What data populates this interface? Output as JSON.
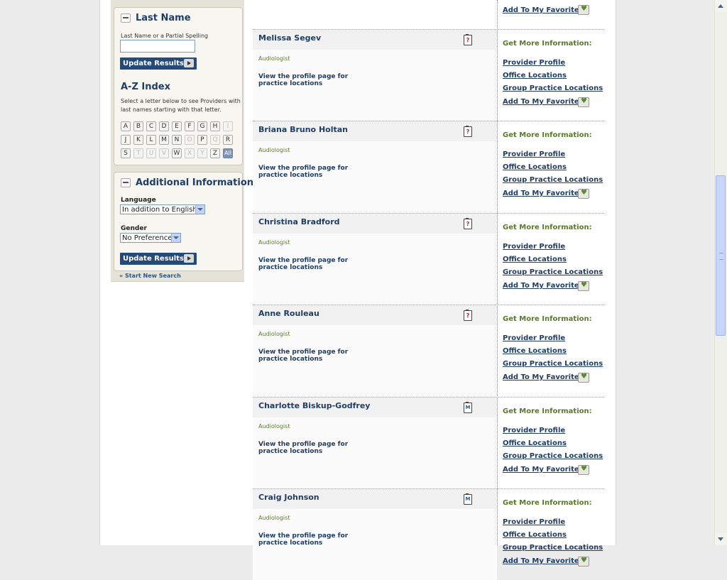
{
  "sidebar": {
    "last_name": {
      "title": "Last Name",
      "input_label": "Last Name or a Partial Spelling",
      "input_value": "",
      "update_label": "Update Results"
    },
    "az": {
      "title": "A-Z Index",
      "description": "Select a letter below to see Providers with last names starting with that letter.",
      "letters": [
        "A",
        "B",
        "C",
        "D",
        "E",
        "F",
        "G",
        "H",
        "I",
        "J",
        "K",
        "L",
        "M",
        "N",
        "O",
        "P",
        "Q",
        "R",
        "S",
        "T",
        "U",
        "V",
        "W",
        "X",
        "Y",
        "Z",
        "All"
      ],
      "disabled": [
        "I",
        "O",
        "Q",
        "T",
        "U",
        "V",
        "X",
        "Y"
      ],
      "selected": "All"
    },
    "additional": {
      "title": "Additional Information",
      "language_label": "Language",
      "language_value": "In addition to English",
      "gender_label": "Gender",
      "gender_value": "No Preference",
      "update_label": "Update Results"
    },
    "start_new": "« Start New Search"
  },
  "prev_card": {
    "fav_label": "Add To My Favorites"
  },
  "providers": [
    {
      "name": "Melissa Segev",
      "specialty": "Audiologist",
      "note": "View the profile page for practice locations",
      "icon": "clipboard-question-icon"
    },
    {
      "name": "Briana Bruno Holtan",
      "specialty": "Audiologist",
      "note": "View the profile page for practice locations",
      "icon": "clipboard-question-icon"
    },
    {
      "name": "Christina Bradford",
      "specialty": "Audiologist",
      "note": "View the profile page for practice locations",
      "icon": "clipboard-question-icon"
    },
    {
      "name": "Anne Rouleau",
      "specialty": "Audiologist",
      "note": "View the profile page for practice locations",
      "icon": "clipboard-question-icon"
    },
    {
      "name": "Charlotte Biskup-Godfrey",
      "specialty": "Audiologist",
      "note": "View the profile page for practice locations",
      "icon": "clipboard-m-icon"
    },
    {
      "name": "Craig Johnson",
      "specialty": "Audiologist",
      "note": "View the profile page for practice locations",
      "icon": "clipboard-m-icon"
    }
  ],
  "card_links": {
    "heading": "Get More Information:",
    "provider_profile": "Provider Profile",
    "office_locations": "Office Locations",
    "group_practice": "Group Practice Locations",
    "add_favorites": "Add To My Favorites"
  },
  "colors": {
    "navy": "#203d63",
    "green": "#5a7a2a",
    "button": "#244a7a"
  }
}
